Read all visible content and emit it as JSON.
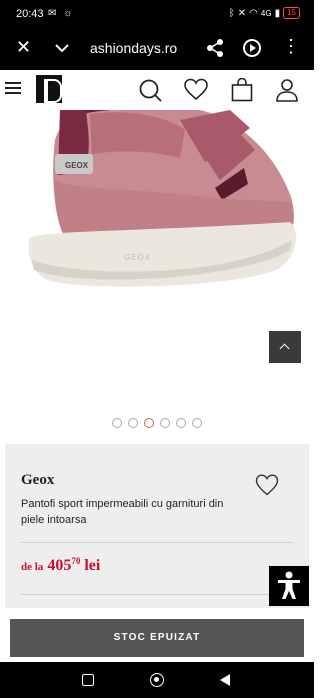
{
  "status_bar": {
    "time": "20:43",
    "left_icons": [
      "mail-icon",
      "bug-icon"
    ],
    "right_icons": [
      "bluetooth-icon",
      "mute-icon",
      "wifi-icon",
      "signal-icon"
    ],
    "network": "4G",
    "battery": "15"
  },
  "browser": {
    "url": "ashiondays.ro"
  },
  "gallery": {
    "dots": [
      false,
      false,
      true,
      false,
      false,
      false
    ]
  },
  "product": {
    "brand": "Geox",
    "description": "Pantofi sport impermeabili cu garnituri din piele intoarsa",
    "price_prefix": "de la",
    "price_int": "405",
    "price_dec": "70",
    "currency": "lei",
    "sole_text": "GEOX",
    "tab_text": "GEOX"
  },
  "cta": {
    "label": "STOC EPUIZAT"
  },
  "colors": {
    "price": "#c8102e",
    "button": "#555555",
    "card": "#eeeeee"
  }
}
